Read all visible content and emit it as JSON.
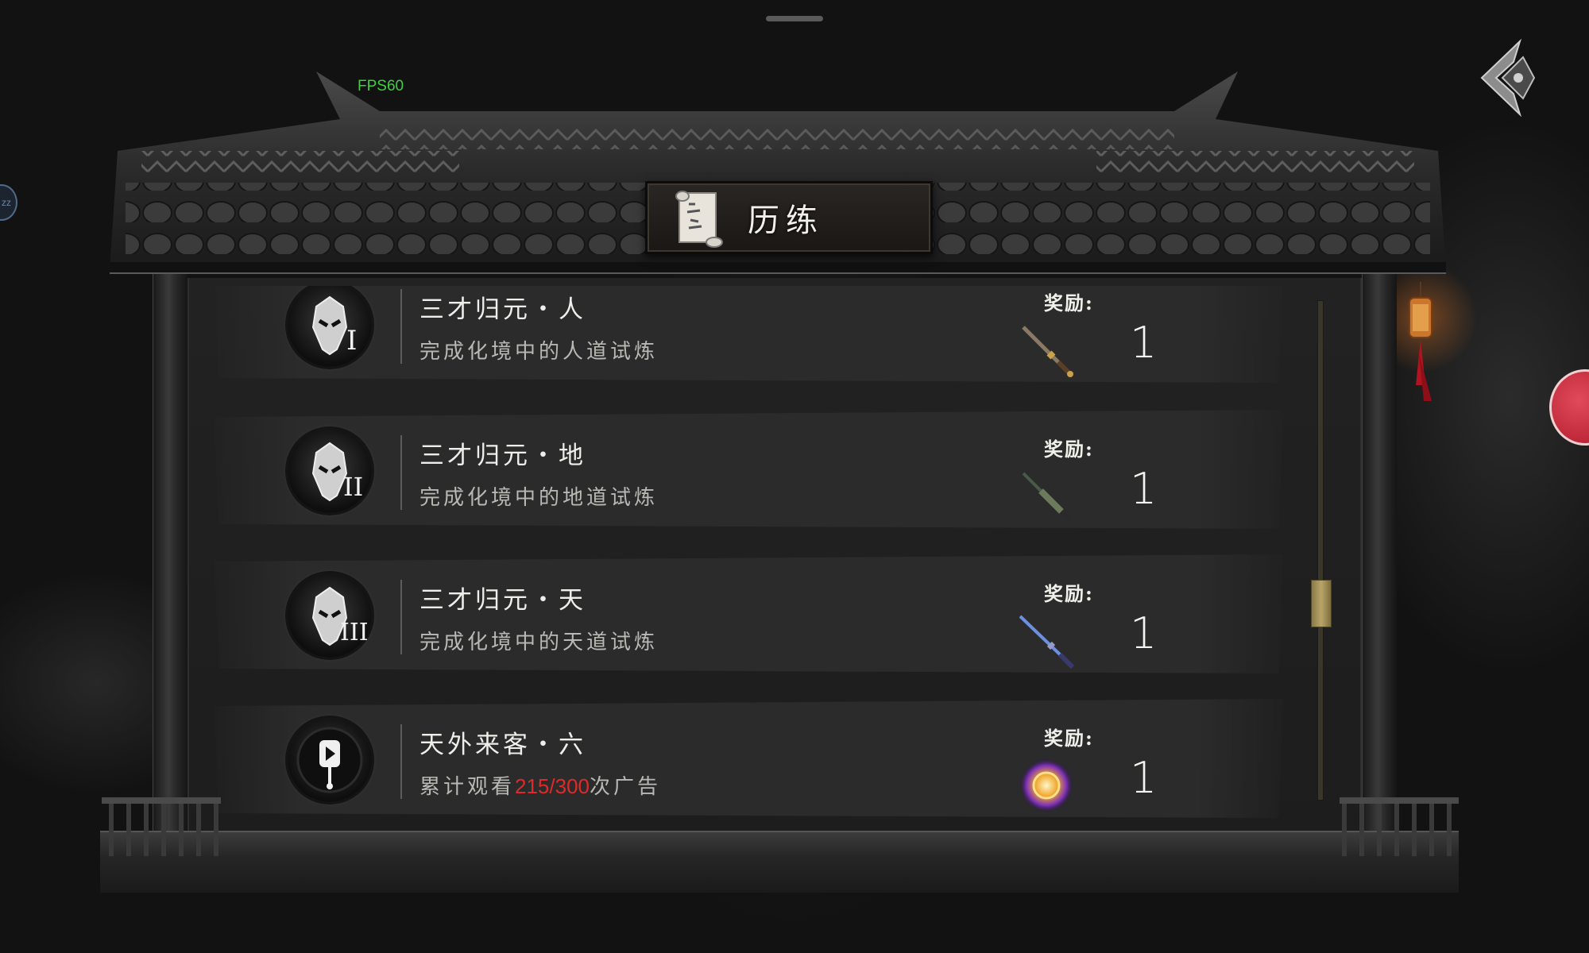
{
  "hud": {
    "fps": "FPS60"
  },
  "header": {
    "title": "历练",
    "title_icon": "scroll-icon",
    "back_icon": "back-arrow-icon"
  },
  "tasks": [
    {
      "title": "三才归元・人",
      "desc": "完成化境中的人道试炼",
      "badge_numeral": "I",
      "badge_icon": "mask-badge-icon",
      "reward_label": "奖励:",
      "reward_icon": "sword-icon",
      "reward_qty": "1"
    },
    {
      "title": "三才归元・地",
      "desc": "完成化境中的地道试炼",
      "badge_numeral": "II",
      "badge_icon": "mask-badge-icon",
      "reward_label": "奖励:",
      "reward_icon": "sword-icon",
      "reward_qty": "1"
    },
    {
      "title": "三才归元・天",
      "desc": "完成化境中的天道试炼",
      "badge_numeral": "III",
      "badge_icon": "mask-badge-icon",
      "reward_label": "奖励:",
      "reward_icon": "blue-sword-icon",
      "reward_qty": "1"
    },
    {
      "title": "天外来客・六",
      "desc_prefix": "累计观看",
      "desc_progress": "215/300",
      "desc_suffix": "次广告",
      "progress_value": 215,
      "progress_max": 300,
      "badge_icon": "video-badge-icon",
      "reward_label": "奖励:",
      "reward_icon": "glowing-orb-icon",
      "reward_qty": "1"
    }
  ],
  "colors": {
    "progress_highlight": "#e02a2a",
    "fps_text": "#3fcf3f",
    "scroll_thumb": "#b9a56a"
  }
}
